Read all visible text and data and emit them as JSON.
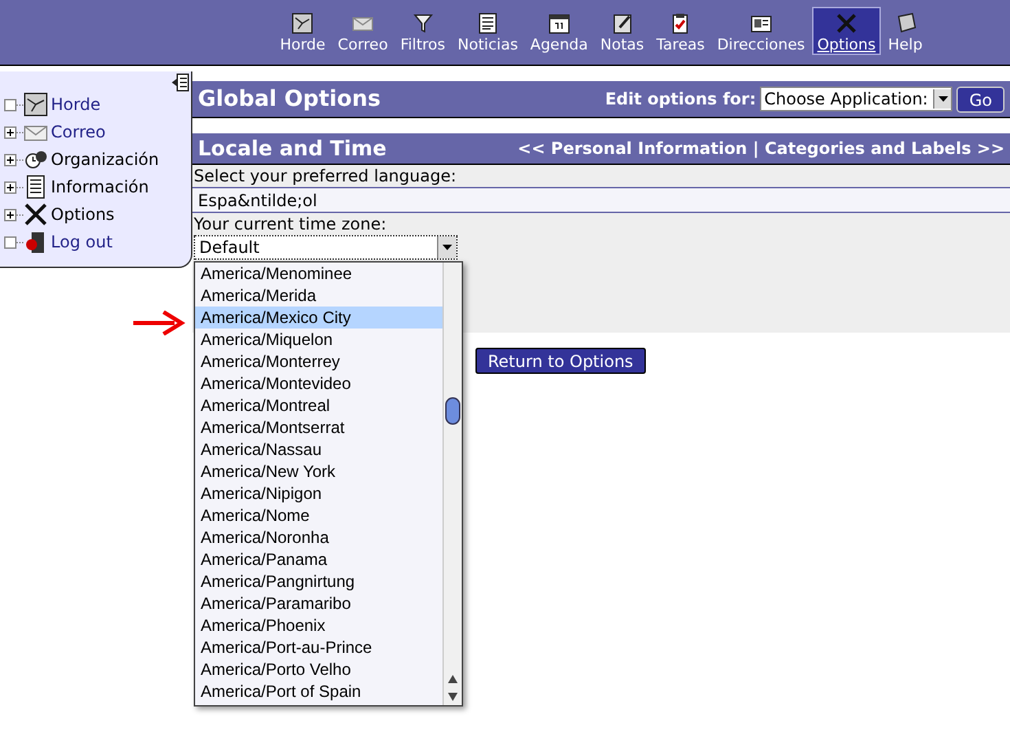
{
  "toolbar": {
    "items": [
      {
        "label": "Horde",
        "selected": false
      },
      {
        "label": "Correo",
        "selected": false
      },
      {
        "label": "Filtros",
        "selected": false
      },
      {
        "label": "Noticias",
        "selected": false
      },
      {
        "label": "Agenda",
        "selected": false
      },
      {
        "label": "Notas",
        "selected": false
      },
      {
        "label": "Tareas",
        "selected": false
      },
      {
        "label": "Direcciones",
        "selected": false
      },
      {
        "label": "Options",
        "selected": true
      },
      {
        "label": "Help",
        "selected": false
      }
    ]
  },
  "sidebar": {
    "items": [
      {
        "label": "Horde",
        "has_children": false,
        "link": true
      },
      {
        "label": "Correo",
        "has_children": true,
        "link": true
      },
      {
        "label": "Organización",
        "has_children": true,
        "link": false
      },
      {
        "label": "Información",
        "has_children": true,
        "link": false
      },
      {
        "label": "Options",
        "has_children": true,
        "link": false
      },
      {
        "label": "Log out",
        "has_children": false,
        "link": true
      }
    ]
  },
  "global_options": {
    "title": "Global Options",
    "edit_label": "Edit options for:",
    "app_select": "Choose Application:",
    "go_button": "Go"
  },
  "section": {
    "title": "Locale and Time",
    "nav": "<< Personal Information | Categories and Labels >>"
  },
  "language": {
    "label": "Select your preferred language:",
    "value": "Espa&ntilde;ol"
  },
  "timezone": {
    "label": "Your current time zone:",
    "value": "Default",
    "open": true,
    "options": [
      {
        "label": "America/Menominee",
        "selected": false
      },
      {
        "label": "America/Merida",
        "selected": false
      },
      {
        "label": "America/Mexico City",
        "selected": true
      },
      {
        "label": "America/Miquelon",
        "selected": false
      },
      {
        "label": "America/Monterrey",
        "selected": false
      },
      {
        "label": "America/Montevideo",
        "selected": false
      },
      {
        "label": "America/Montreal",
        "selected": false
      },
      {
        "label": "America/Montserrat",
        "selected": false
      },
      {
        "label": "America/Nassau",
        "selected": false
      },
      {
        "label": "America/New York",
        "selected": false
      },
      {
        "label": "America/Nipigon",
        "selected": false
      },
      {
        "label": "America/Nome",
        "selected": false
      },
      {
        "label": "America/Noronha",
        "selected": false
      },
      {
        "label": "America/Panama",
        "selected": false
      },
      {
        "label": "America/Pangnirtung",
        "selected": false
      },
      {
        "label": "America/Paramaribo",
        "selected": false
      },
      {
        "label": "America/Phoenix",
        "selected": false
      },
      {
        "label": "America/Port-au-Prince",
        "selected": false
      },
      {
        "label": "America/Porto Velho",
        "selected": false
      },
      {
        "label": "America/Port of Spain",
        "selected": false
      }
    ]
  },
  "return_button": "Return to Options"
}
